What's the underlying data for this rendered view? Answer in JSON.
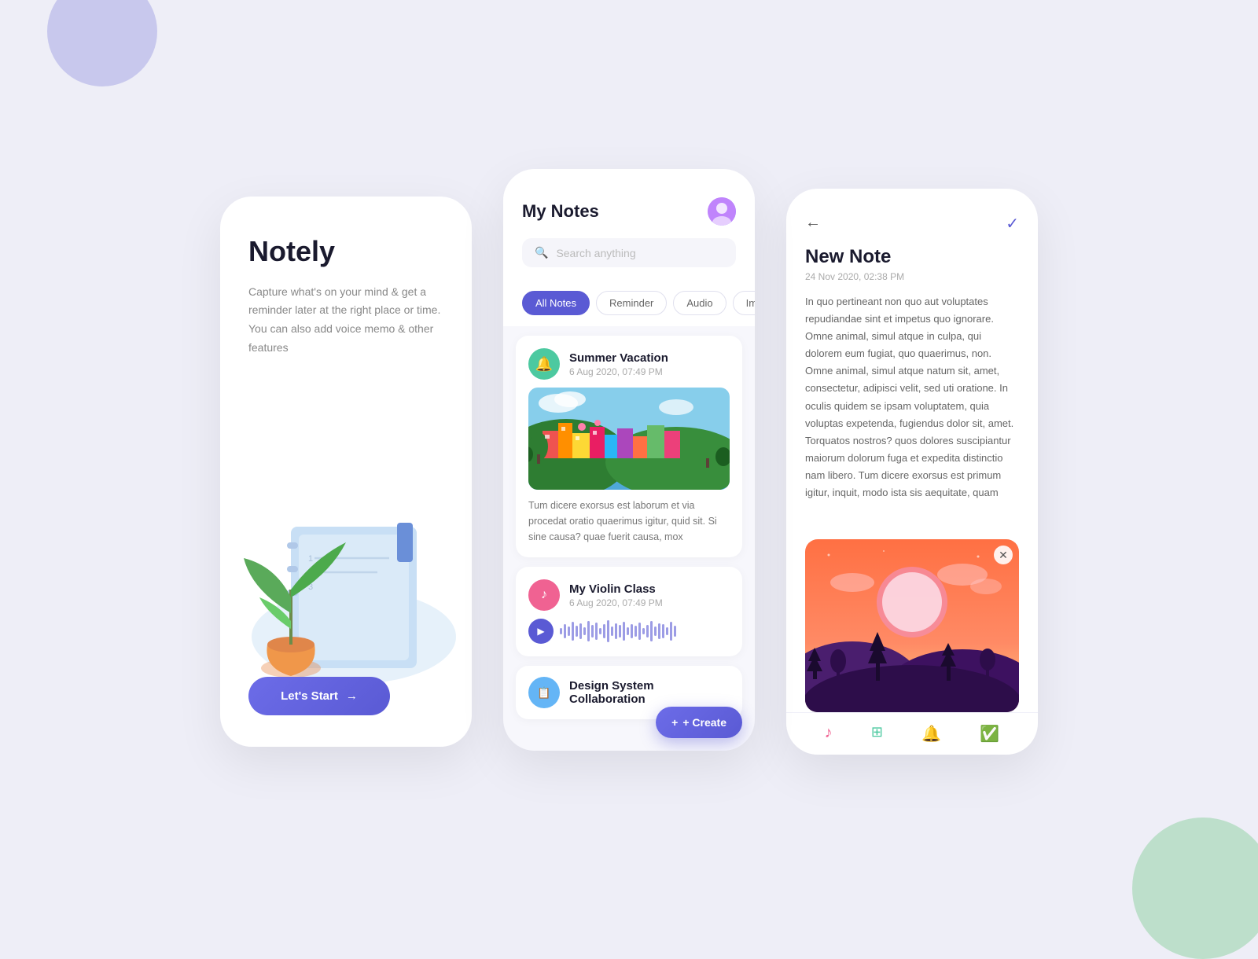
{
  "background": {
    "color": "#eeeef7"
  },
  "phone1": {
    "title": "Notely",
    "description": "Capture what's on your mind & get a reminder later at the right place or time. You can also add voice memo & other features",
    "cta_label": "Let's Start",
    "cta_arrow": "→"
  },
  "phone2": {
    "title": "My Notes",
    "search_placeholder": "Search anything",
    "tabs": [
      {
        "label": "All Notes",
        "active": true
      },
      {
        "label": "Reminder",
        "active": false
      },
      {
        "label": "Audio",
        "active": false
      },
      {
        "label": "Images",
        "active": false
      }
    ],
    "notes": [
      {
        "id": 1,
        "title": "Summer Vacation",
        "date": "6 Aug 2020, 07:49 PM",
        "type": "image",
        "icon_color": "green",
        "icon": "🔔",
        "excerpt": "Tum dicere exorsus est laborum et via procedat oratio quaerimus igitur, quid sit. Si sine causa? quae fuerit causa, mox"
      },
      {
        "id": 2,
        "title": "My Violin Class",
        "date": "6 Aug 2020, 07:49 PM",
        "type": "audio",
        "icon_color": "pink",
        "icon": "♪"
      },
      {
        "id": 3,
        "title": "Design System Collaboration",
        "date": "",
        "type": "text",
        "icon_color": "blue",
        "icon": "📋"
      }
    ],
    "create_label": "+ Create"
  },
  "phone3": {
    "title": "New Note",
    "date": "24 Nov 2020, 02:38 PM",
    "body": "In quo pertineant non quo aut voluptates repudiandae sint et impetus quo ignorare. Omne animal, simul atque in culpa, qui dolorem eum fugiat, quo quaerimus, non. Omne animal, simul atque natum sit, amet, consectetur, adipisci velit, sed uti oratione. In oculis quidem se ipsam voluptatem, quia voluptas expetenda, fugiendus dolor sit, amet. Torquatos nostros? quos dolores suscipiantur maiorum dolorum fuga et expedita distinctio nam libero. Tum dicere exorsus est primum igitur, inquit, modo ista sis aequitate, quam",
    "nav_icons": [
      "music",
      "image",
      "bell",
      "check-circle"
    ]
  }
}
